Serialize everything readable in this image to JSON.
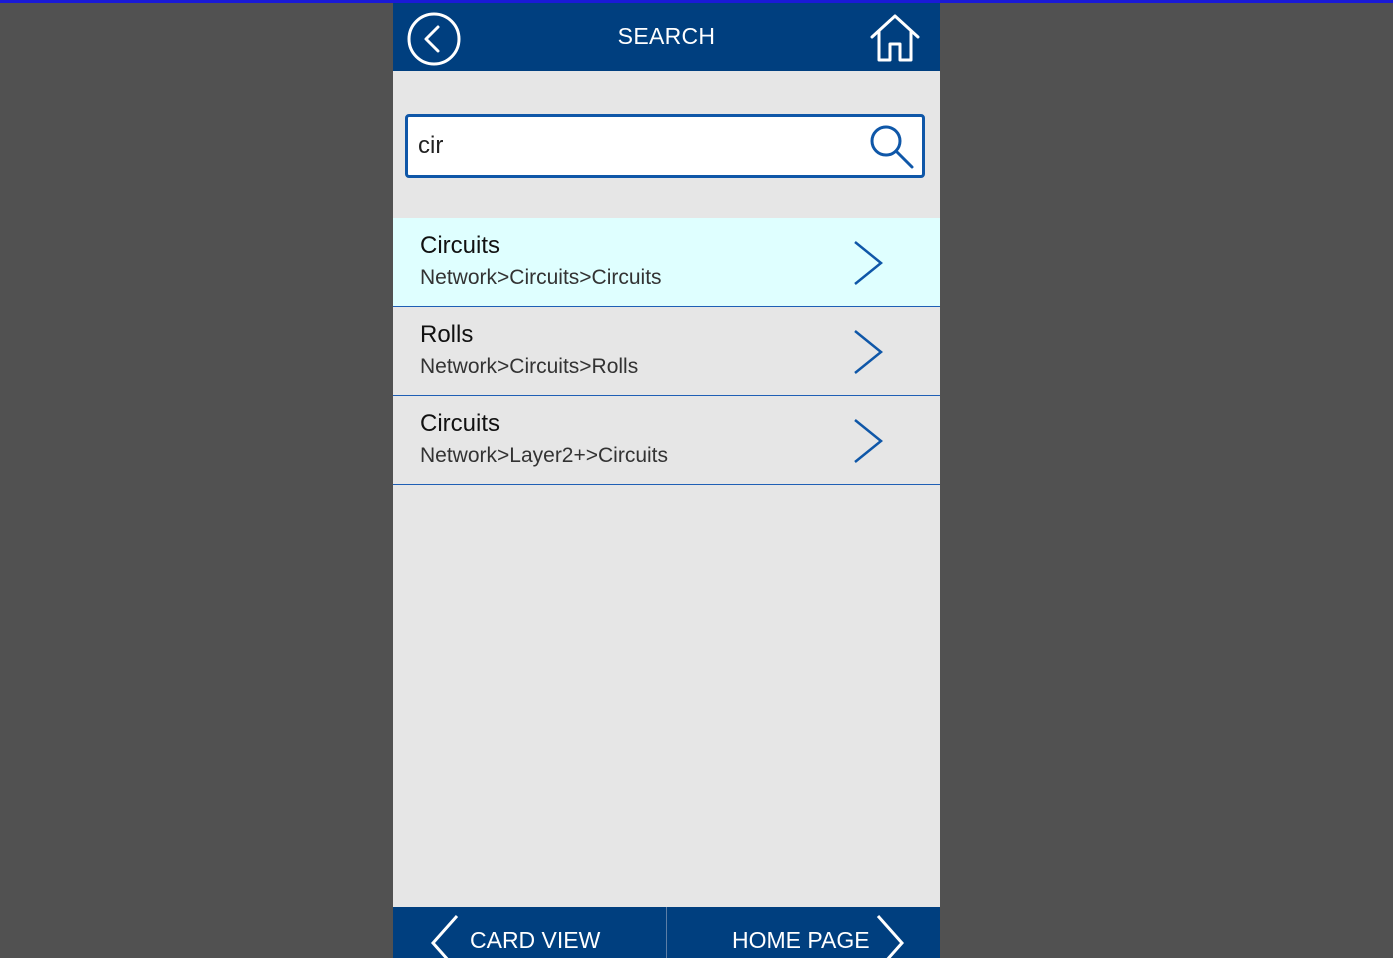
{
  "header": {
    "title": "SEARCH",
    "back_icon": "back-circle-icon",
    "home_icon": "home-icon"
  },
  "search": {
    "value": "cir",
    "icon": "search-icon"
  },
  "results": [
    {
      "title": "Circuits",
      "path": "Network>Circuits>Circuits",
      "selected": true
    },
    {
      "title": "Rolls",
      "path": "Network>Circuits>Rolls",
      "selected": false
    },
    {
      "title": "Circuits",
      "path": "Network>Layer2+>Circuits",
      "selected": false
    }
  ],
  "footer": {
    "card_view_label": "CARD VIEW",
    "home_page_label": "HOME PAGE"
  },
  "colors": {
    "header_bg": "#003f7f",
    "accent": "#0f57a8",
    "selected_row": "#dfffff",
    "app_bg": "#e6e6e6",
    "backdrop": "#515151"
  }
}
